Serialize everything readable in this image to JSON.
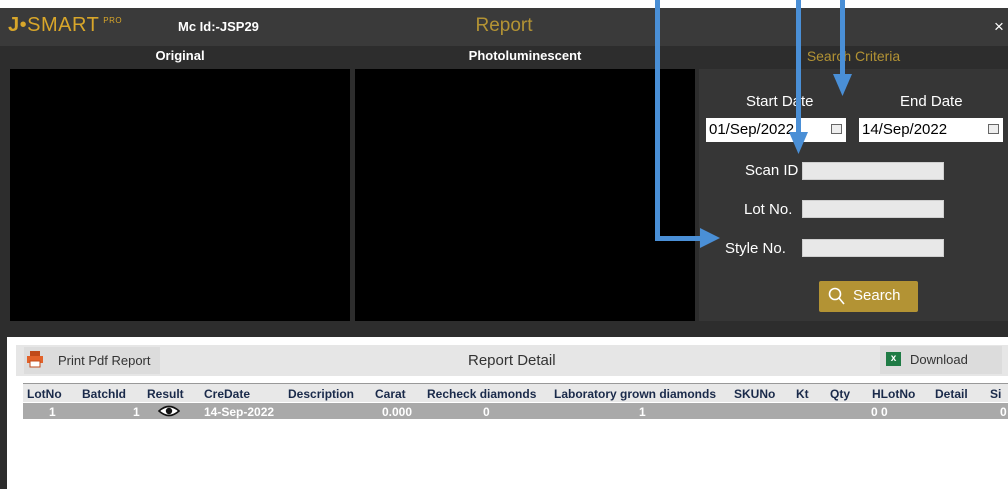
{
  "app": {
    "logo_j": "J",
    "logo_dot": "•",
    "logo_smart": "SMART",
    "logo_pro": "PRO",
    "machine_id": "Mc Id:-JSP29",
    "title": "Report",
    "close": "×"
  },
  "panels": {
    "original": "Original",
    "photoluminescent": "Photoluminescent"
  },
  "criteria": {
    "header": "Search Criteria",
    "start_label": "Start Date",
    "end_label": "End Date",
    "start_value": "01/Sep/2022",
    "end_value": "14/Sep/2022",
    "scan_label": "Scan ID",
    "lot_label": "Lot No.",
    "style_label": "Style No.",
    "search_label": "Search",
    "scan_value": "",
    "lot_value": "",
    "style_value": ""
  },
  "detail": {
    "print_label": "Print Pdf Report",
    "title": "Report Detail",
    "download_label": "Download",
    "excel_icon_text": "x"
  },
  "table": {
    "columns": [
      "LotNo",
      "BatchId",
      "Result",
      "CreDate",
      "Description",
      "Carat",
      "Recheck diamonds",
      "Laboratory grown diamonds",
      "SKUNo",
      "Kt",
      "Qty",
      "HLotNo",
      "Detail",
      "Si"
    ],
    "row": {
      "lotno": "1",
      "batchid": "1",
      "credate": "14-Sep-2022",
      "carat": "0.000",
      "recheck": "0",
      "lab_grown": "1",
      "hlotno": "0 0",
      "si": "0"
    }
  },
  "colors": {
    "gold": "#b39334",
    "annotation_arrow": "#4a8fd6"
  }
}
